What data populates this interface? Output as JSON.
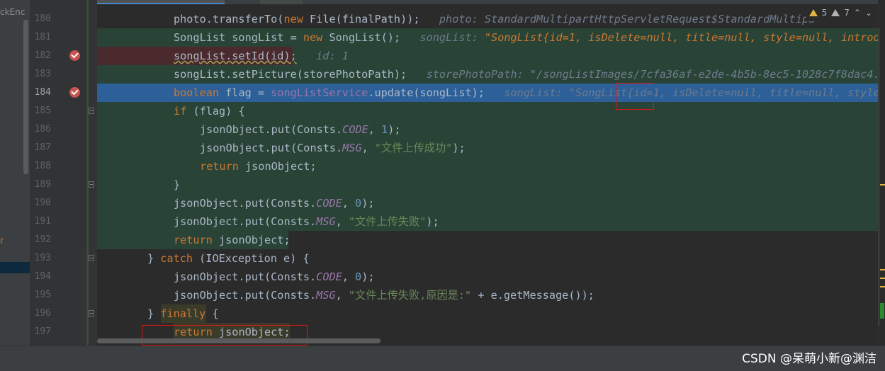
{
  "left_panel": {
    "truncated_text": "ckEnc",
    "mark": "r"
  },
  "editor": {
    "lines": [
      {
        "num": "180",
        "tokens": [
          {
            "t": "photo.transferTo(",
            "c": ""
          },
          {
            "t": "new",
            "c": "kw"
          },
          {
            "t": " File(finalPath));",
            "c": ""
          },
          {
            "t": "   photo: StandardMultipartHttpServletRequest$StandardMultipa",
            "c": "inlay"
          }
        ]
      },
      {
        "num": "181",
        "tokens": [
          {
            "t": "SongList songList = ",
            "c": ""
          },
          {
            "t": "new",
            "c": "kw"
          },
          {
            "t": " SongList();",
            "c": ""
          },
          {
            "t": "   songList: ",
            "c": "inlay"
          },
          {
            "t": "\"SongList{id=1, isDelete=null, title=null, style=null, introduc",
            "c": "inlay-str"
          }
        ]
      },
      {
        "num": "182",
        "tokens": [
          {
            "t": "songList.setId(id);",
            "c": "warn"
          },
          {
            "t": "   id: 1",
            "c": "inlay"
          }
        ]
      },
      {
        "num": "183",
        "tokens": [
          {
            "t": "songList.setPicture(storePhotoPath);",
            "c": ""
          },
          {
            "t": "   storePhotoPath: \"/songListImages/7cfa36af-e2de-4b5b-8ec5-1028c7f8dac4.jp",
            "c": "inlay"
          }
        ]
      },
      {
        "num": "184",
        "tokens": [
          {
            "t": "boolean",
            "c": "kw"
          },
          {
            "t": " flag = ",
            "c": ""
          },
          {
            "t": "songListService",
            "c": "fld"
          },
          {
            "t": ".update(songList);",
            "c": ""
          },
          {
            "t": "   songList: \"SongList{id=1, isDelete=null, title=null, style=nu",
            "c": "inlay"
          }
        ]
      },
      {
        "num": "185",
        "tokens": [
          {
            "t": "if",
            "c": "kw"
          },
          {
            "t": " (flag) {",
            "c": ""
          }
        ]
      },
      {
        "num": "186",
        "tokens": [
          {
            "t": "jsonObject.put(Consts.",
            "c": ""
          },
          {
            "t": "CODE",
            "c": "fld-i"
          },
          {
            "t": ", ",
            "c": ""
          },
          {
            "t": "1",
            "c": "num"
          },
          {
            "t": ");",
            "c": ""
          }
        ]
      },
      {
        "num": "187",
        "tokens": [
          {
            "t": "jsonObject.put(Consts.",
            "c": ""
          },
          {
            "t": "MSG",
            "c": "fld-i"
          },
          {
            "t": ", ",
            "c": ""
          },
          {
            "t": "\"文件上传成功\"",
            "c": "str"
          },
          {
            "t": ");",
            "c": ""
          }
        ]
      },
      {
        "num": "188",
        "tokens": [
          {
            "t": "return",
            "c": "kw"
          },
          {
            "t": " jsonObject;",
            "c": ""
          }
        ]
      },
      {
        "num": "189",
        "tokens": [
          {
            "t": "}",
            "c": ""
          }
        ]
      },
      {
        "num": "190",
        "tokens": [
          {
            "t": "jsonObject.put(Consts.",
            "c": ""
          },
          {
            "t": "CODE",
            "c": "fld-i"
          },
          {
            "t": ", ",
            "c": ""
          },
          {
            "t": "0",
            "c": "num"
          },
          {
            "t": ");",
            "c": ""
          }
        ]
      },
      {
        "num": "191",
        "tokens": [
          {
            "t": "jsonObject.put(Consts.",
            "c": ""
          },
          {
            "t": "MSG",
            "c": "fld-i"
          },
          {
            "t": ", ",
            "c": ""
          },
          {
            "t": "\"文件上传失败\"",
            "c": "str"
          },
          {
            "t": ");",
            "c": ""
          }
        ]
      },
      {
        "num": "192",
        "tokens": [
          {
            "t": "return",
            "c": "kw"
          },
          {
            "t": " jsonObject;",
            "c": ""
          }
        ]
      },
      {
        "num": "193",
        "tokens": [
          {
            "t": "} ",
            "c": ""
          },
          {
            "t": "catch",
            "c": "kw"
          },
          {
            "t": " (IOException e) {",
            "c": ""
          }
        ]
      },
      {
        "num": "194",
        "tokens": [
          {
            "t": "jsonObject.put(Consts.",
            "c": ""
          },
          {
            "t": "CODE",
            "c": "fld-i"
          },
          {
            "t": ", ",
            "c": ""
          },
          {
            "t": "0",
            "c": "num"
          },
          {
            "t": ");",
            "c": ""
          }
        ]
      },
      {
        "num": "195",
        "tokens": [
          {
            "t": "jsonObject.put(Consts.",
            "c": ""
          },
          {
            "t": "MSG",
            "c": "fld-i"
          },
          {
            "t": ", ",
            "c": ""
          },
          {
            "t": "\"文件上传失败,原因是:\"",
            "c": "str"
          },
          {
            "t": " + e.getMessage());",
            "c": ""
          }
        ]
      },
      {
        "num": "196",
        "tokens": [
          {
            "t": "} ",
            "c": ""
          },
          {
            "t": "finally",
            "c": "kw"
          },
          {
            "t": " {",
            "c": ""
          }
        ]
      },
      {
        "num": "197",
        "tokens": [
          {
            "t": "return",
            "c": "kw"
          },
          {
            "t": " jsonObject;",
            "c": ""
          }
        ]
      }
    ]
  },
  "inspections": {
    "warnings": "5",
    "weak_warnings": "7",
    "up_arrow": "⌃",
    "down_arrow": "⌄"
  },
  "watermark": "CSDN @呆萌小新@渊洁",
  "colors": {
    "background": "#2b2b2b",
    "coverage_green": "#294436",
    "execution_blue": "#2d6099",
    "breakpoint_red": "#c75450",
    "keyword": "#cc7832"
  }
}
